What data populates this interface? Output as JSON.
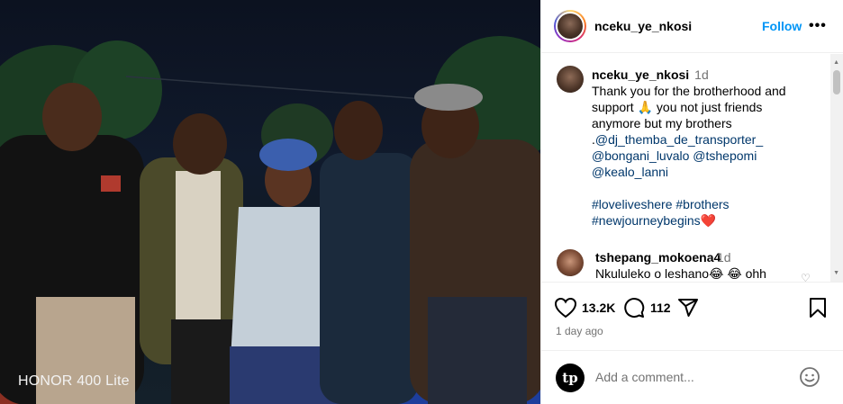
{
  "photo": {
    "watermark": "HONOR 400 Lite"
  },
  "header": {
    "username": "nceku_ye_nkosi",
    "follow_label": "Follow",
    "more_label": "•••"
  },
  "caption": {
    "username": "nceku_ye_nkosi",
    "time_ago": "1d",
    "text_lines": [
      "Thank you for the brotherhood and",
      "support 🙏 you not just friends",
      "anymore but my brothers"
    ],
    "dot": ".",
    "mentions": [
      "@dj_themba_de_transporter_",
      "@bongani_luvalo",
      "@tshepomi",
      "@kealo_lanni"
    ],
    "hashtags": [
      "#loveliveshere",
      "#brothers",
      "#newjourneybegins"
    ],
    "heart_emoji": "❤️"
  },
  "comment2": {
    "username": "tshepang_mokoena4",
    "time_ago": "1d",
    "text": "Nkululeko o leshano😂 😂 ohh"
  },
  "actions": {
    "likes": "13.2K",
    "comments": "112",
    "time_ago": "1 day ago"
  },
  "add_comment": {
    "placeholder": "Add a comment...",
    "avatar_initials": "tp"
  }
}
